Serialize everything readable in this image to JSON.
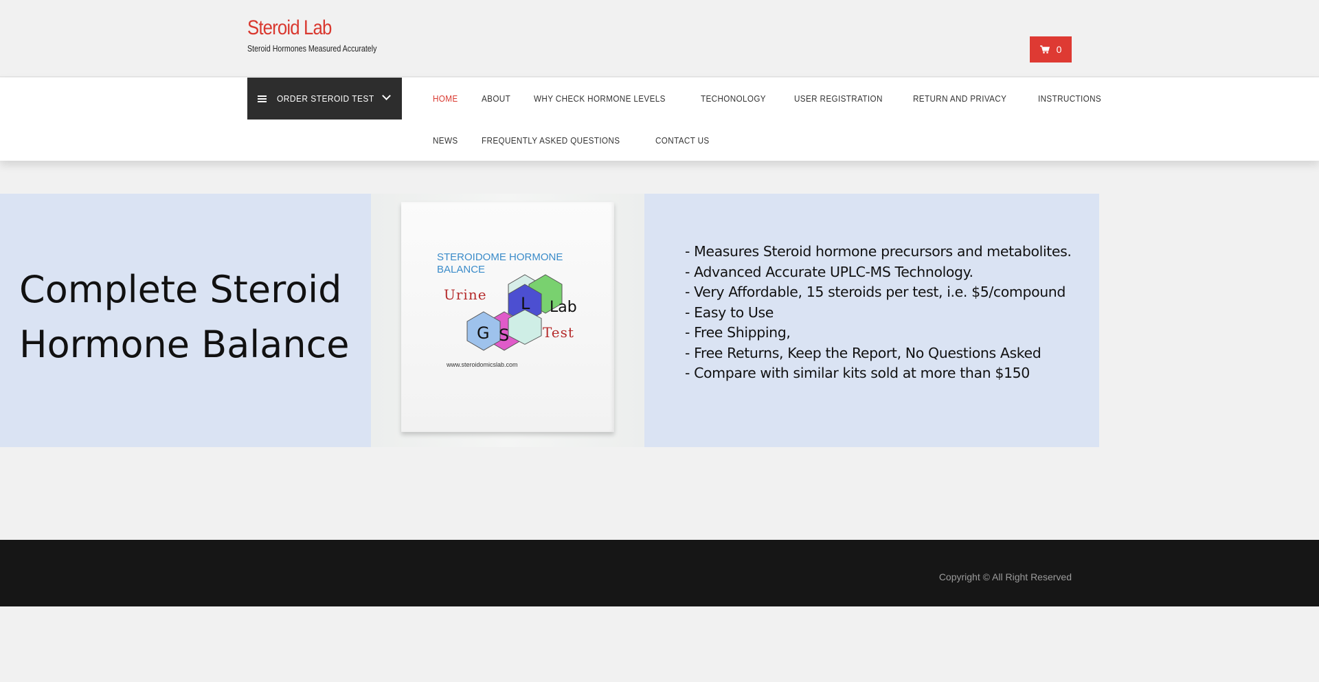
{
  "header": {
    "site_title": "Steroid Lab",
    "tagline": "Steroid Hormones Measured Accurately",
    "cart_count": "0",
    "cart_icon": "shopping-cart-icon"
  },
  "nav": {
    "order_menu_label": "ORDER STEROID TEST",
    "links_row1": [
      {
        "label": "HOME",
        "active": true
      },
      {
        "label": "ABOUT"
      },
      {
        "label": "WHY CHECK HORMONE LEVELS"
      },
      {
        "label": "TECHONOLOGY"
      },
      {
        "label": "USER REGISTRATION"
      },
      {
        "label": "RETURN AND PRIVACY"
      },
      {
        "label": "INSTRUCTIONS"
      }
    ],
    "links_row2": [
      {
        "label": "NEWS"
      },
      {
        "label": "FREQUENTLY ASKED QUESTIONS"
      },
      {
        "label": "CONTACT US"
      }
    ]
  },
  "banner": {
    "heading_line1": "Complete Steroid",
    "heading_line2": "Hormone Balance",
    "product": {
      "title": "STEROIDOME HORMONE\nBALANCE",
      "urine": "Urine",
      "test": "Test",
      "hex_labels": [
        "L",
        "Lab",
        "G",
        "S"
      ],
      "url": "www.steroidomicslab.com"
    },
    "bullets": [
      "- Measures Steroid hormone precursors and metabolites.",
      "- Advanced Accurate UPLC-MS Technology.",
      "- Very Affordable, 15 steroids per test, i.e. $5/compound",
      "- Easy to Use",
      "- Free Shipping,",
      "- Free Returns, Keep the Report, No Questions Asked",
      "- Compare with similar kits sold at more than $150"
    ]
  },
  "footer": {
    "copyright": "Copyright © All Right Reserved"
  },
  "colors": {
    "accent": "#d9382f",
    "banner_bg": "#dae3f3",
    "footer_bg": "#161616",
    "menu_dark": "#2d2d2d"
  }
}
